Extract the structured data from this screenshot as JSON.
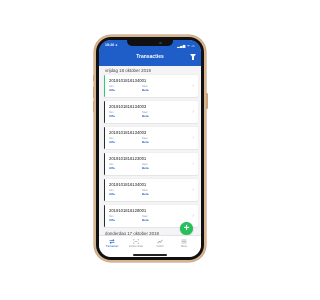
{
  "status": {
    "time": "15:26 ◂",
    "icons": "▂▄▆ ᯤ ▭"
  },
  "header": {
    "title": "Transacties"
  },
  "groups": [
    {
      "date": "vrijdag 18 oktober 2019"
    },
    {
      "date": "donderdag 17 oktober 2019"
    }
  ],
  "transactions": [
    {
      "id": "2019101816134001",
      "from_label": "Van",
      "from": "Alfa",
      "to_label": "Naar",
      "to": "Beta",
      "accent": "#2ecc71"
    },
    {
      "id": "2019101816134003",
      "from_label": "Van",
      "from": "Alfa",
      "to_label": "Naar",
      "to": "Beta",
      "accent": "#2b2b2b"
    },
    {
      "id": "2019101816134003",
      "from_label": "Van",
      "from": "Alfa",
      "to_label": "Naar",
      "to": "Beta",
      "accent": "#2b2b2b"
    },
    {
      "id": "2019101816123001",
      "from_label": "Van",
      "from": "Alfa",
      "to_label": "Naar",
      "to": "Beta",
      "accent": "#2b2b2b"
    },
    {
      "id": "2019101816134001",
      "from_label": "Van",
      "from": "Alfa",
      "to_label": "Naar",
      "to": "Beta",
      "accent": "#2b2b2b"
    },
    {
      "id": "2019101816128001",
      "from_label": "Van",
      "from": "Alfa",
      "to_label": "Naar",
      "to": "Beta",
      "accent": "#2b2b2b"
    }
  ],
  "fab": {
    "label": "+"
  },
  "nav": [
    {
      "label": "Transacties",
      "icon": "transfer-icon"
    },
    {
      "label": "Invoice Scan",
      "icon": "scan-icon"
    },
    {
      "label": "Inzicht",
      "icon": "chart-icon"
    },
    {
      "label": "Menu",
      "icon": "menu-icon"
    }
  ],
  "colors": {
    "primary": "#1f5ec9",
    "fab": "#26c05a",
    "frame": "#d8b590"
  }
}
